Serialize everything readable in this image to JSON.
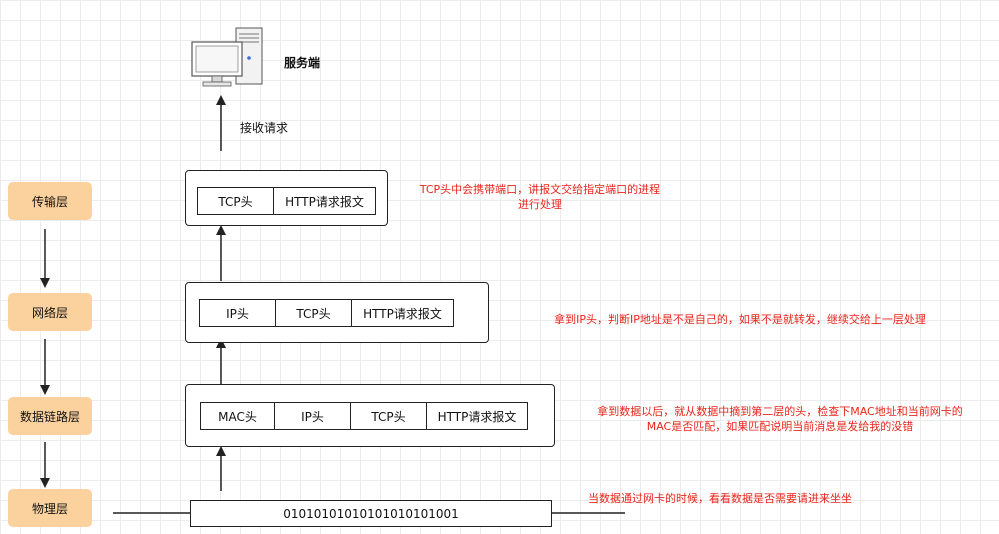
{
  "server": {
    "label": "服务端"
  },
  "receive": {
    "label": "接收请求"
  },
  "layers": {
    "transport": "传输层",
    "network": "网络层",
    "datalink": "数据链路层",
    "physical": "物理层"
  },
  "packets": {
    "transport": [
      "TCP头",
      "HTTP请求报文"
    ],
    "network": [
      "IP头",
      "TCP头",
      "HTTP请求报文"
    ],
    "datalink": [
      "MAC头",
      "IP头",
      "TCP头",
      "HTTP请求报文"
    ],
    "physical": "01010101010101010101001"
  },
  "notes": {
    "transport_line1": "TCP头中会携带端口，讲报文交给指定端口的进程",
    "transport_line2": "进行处理",
    "network": "拿到IP头，判断IP地址是不是自己的，如果不是就转发，继续交给上一层处理",
    "datalink_line1": "拿到数据以后，就从数据中摘到第二层的头，检查下MAC地址和当前网卡的",
    "datalink_line2": "MAC是否匹配，如果匹配说明当前消息是发给我的没错",
    "physical": "当数据通过网卡的时候，看看数据是否需要请进来坐坐"
  },
  "colors": {
    "layer_fill": "#fbd29e",
    "note_text": "#e8261c"
  }
}
